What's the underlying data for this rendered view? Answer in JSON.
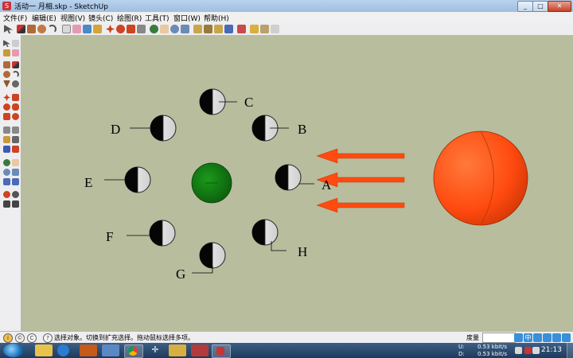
{
  "window": {
    "title": "活动一 月相.skp - SketchUp"
  },
  "menu": [
    "文件(F)",
    "编辑(E)",
    "视图(V)",
    "镜头(C)",
    "绘图(R)",
    "工具(T)",
    "窗口(W)",
    "帮助(H)"
  ],
  "toolbar_icons": [
    "select-icon",
    "pencil-icon",
    "rectangle-icon",
    "circle-icon",
    "arc-icon",
    "make-component-icon",
    "eraser-icon",
    "paint-bucket-icon",
    "push-pull-icon",
    "move-icon",
    "rotate-icon",
    "offset-icon",
    "tape-measure-icon",
    "orbit-icon",
    "pan-icon",
    "zoom-icon",
    "zoom-extents-icon",
    "front-view-icon",
    "top-view-icon",
    "iso-view-icon",
    "right-view-icon",
    "xray-icon",
    "wireframe-icon",
    "shaded-icon",
    "textured-icon",
    "monochrome-icon"
  ],
  "scene": {
    "earth_color": "#127a12",
    "sun_color": "#ff4a10",
    "arrow_color": "#ff4a10",
    "moon_labels": {
      "A": "A",
      "B": "B",
      "C": "C",
      "D": "D",
      "E": "E",
      "F": "F",
      "G": "G",
      "H": "H"
    }
  },
  "status": {
    "hint": "选择对象。切换到扩充选择。拖动鼠标选择多项。",
    "measure_label": "度量"
  },
  "taskbar": {
    "net_up": "0.53 kbit/s",
    "net_down": "0.53 kbit/s",
    "net_up_label": "U:",
    "net_down_label": "D:",
    "clock": "21:13"
  }
}
